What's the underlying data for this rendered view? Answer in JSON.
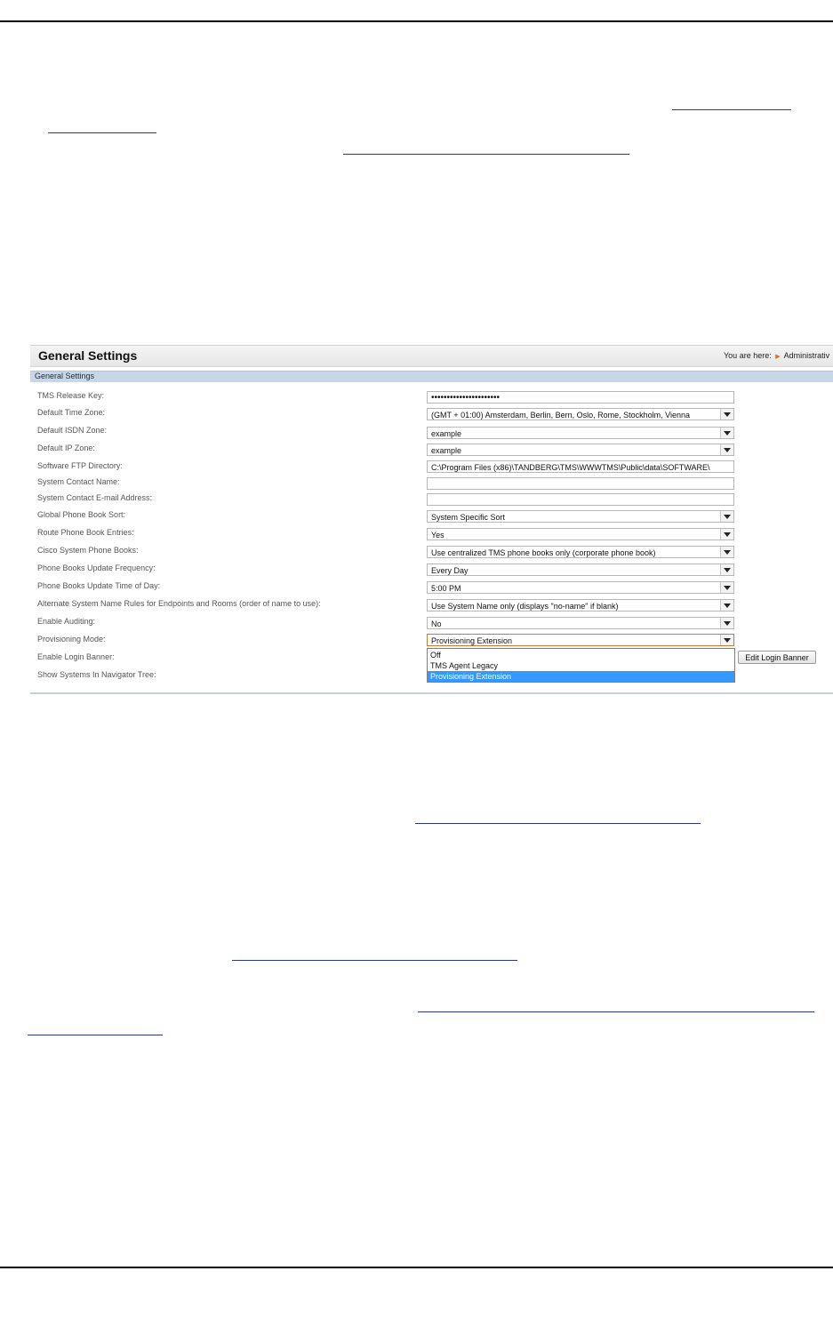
{
  "page": {
    "title": "General Settings",
    "breadcrumb_prefix": "You are here:",
    "breadcrumb_item": "Administrativ",
    "section": "General Settings"
  },
  "rows": [
    {
      "label": "TMS Release Key:",
      "value": "••••••••••••••••••••••",
      "type": "password"
    },
    {
      "label": "Default Time Zone:",
      "value": "(GMT + 01:00) Amsterdam, Berlin, Bern, Oslo, Rome, Stockholm, Vienna",
      "type": "select"
    },
    {
      "label": "Default ISDN Zone:",
      "value": "example",
      "type": "select"
    },
    {
      "label": "Default IP Zone:",
      "value": "example",
      "type": "select"
    },
    {
      "label": "Software FTP Directory:",
      "value": "C:\\Program Files (x86)\\TANDBERG\\TMS\\WWWTMS\\Public\\data\\SOFTWARE\\",
      "type": "text"
    },
    {
      "label": "System Contact Name:",
      "value": "",
      "type": "text"
    },
    {
      "label": "System Contact E-mail Address:",
      "value": "",
      "type": "text"
    },
    {
      "label": "Global Phone Book Sort:",
      "value": "System Specific Sort",
      "type": "select"
    },
    {
      "label": "Route Phone Book Entries:",
      "value": "Yes",
      "type": "select"
    },
    {
      "label": "Cisco System Phone Books:",
      "value": "Use centralized TMS phone books only (corporate phone book)",
      "type": "select"
    },
    {
      "label": "Phone Books Update Frequency:",
      "value": "Every Day",
      "type": "select"
    },
    {
      "label": "Phone Books Update Time of Day:",
      "value": "5:00 PM",
      "type": "select"
    },
    {
      "label": "Alternate System Name Rules for Endpoints and Rooms (order of name to use):",
      "value": "Use System Name only (displays \"no-name\" if blank)",
      "type": "select"
    },
    {
      "label": "Enable Auditing:",
      "value": "No",
      "type": "select"
    },
    {
      "label": "Provisioning Mode:",
      "value": "Provisioning Extension",
      "type": "select"
    },
    {
      "label": "Enable Login Banner:"
    },
    {
      "label": "Show Systems In Navigator Tree:"
    }
  ],
  "provisioning_options": [
    "Off",
    "TMS Agent Legacy",
    "Provisioning Extension"
  ],
  "edit_login_banner": "Edit Login Banner",
  "colors": {
    "section_bar": "#c8d7e8",
    "selected_option": "#3399ff",
    "breadcrumb_arrow": "#e06a1e"
  }
}
